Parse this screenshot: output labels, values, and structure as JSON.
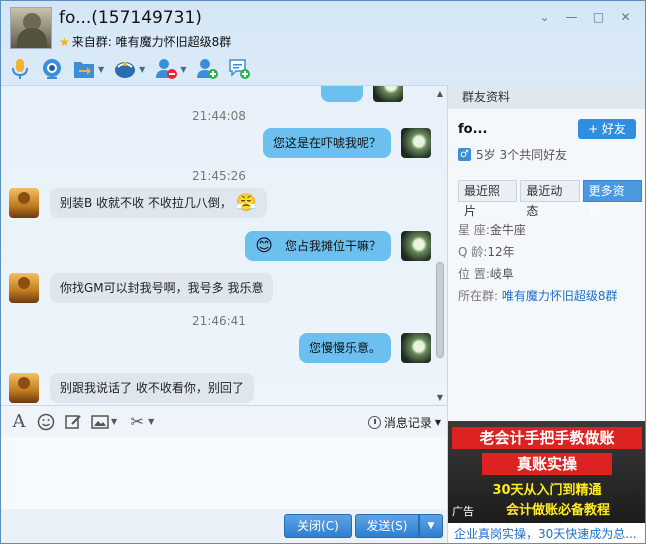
{
  "header": {
    "title": "fo...(157149731)",
    "from_label": "来自群:",
    "group_name": "唯有魔力怀旧超级8群"
  },
  "window_controls": {
    "dropdown": "⌄",
    "minimize": "—",
    "maximize": "□",
    "close": "✕"
  },
  "chat": {
    "messages": [
      {
        "kind": "time",
        "text": "21:44:08"
      },
      {
        "kind": "me",
        "text": "您这是在吓唬我呢？"
      },
      {
        "kind": "time",
        "text": "21:45:26"
      },
      {
        "kind": "them",
        "text": "别装B  收就不收  不收拉几八倒，"
      },
      {
        "kind": "me",
        "text": "您占我摊位干嘛？"
      },
      {
        "kind": "them",
        "text": "你找GM可以封我号啊，我号多 我乐意"
      },
      {
        "kind": "time",
        "text": "21:46:41"
      },
      {
        "kind": "me",
        "text": "您慢慢乐意。"
      },
      {
        "kind": "them",
        "text": "别跟我说话了 收不收看你，别回了"
      }
    ]
  },
  "input": {
    "history_label": "消息记录",
    "close_label": "关闭(C)",
    "send_label": "发送(S)"
  },
  "panel": {
    "header": "群友资料",
    "name": "fo...",
    "add_friend": "+ 好友",
    "info": "5岁 3个共同好友",
    "tabs": [
      "最近照片",
      "最近动态",
      "更多资料"
    ],
    "fields": {
      "constellation_label": "星  座:",
      "constellation": "金牛座",
      "age_label": "Q    龄:",
      "age": "12年",
      "location_label": "位  置:",
      "location": "岐阜",
      "group_label": "所在群:",
      "group": "唯有魔力怀旧超级8群"
    },
    "ad": {
      "line1": "老会计手把手教做账",
      "line2": "真账实操",
      "line3": "30天从入门到精通",
      "line4": "会计做账必备教程",
      "tag": "广告",
      "caption": "企业真岗实操，30天快速成为总..."
    }
  },
  "colors": {
    "accent": "#2f8ee0",
    "my_bubble": "#6cc0f0",
    "their_bubble": "#dfe6ee"
  }
}
